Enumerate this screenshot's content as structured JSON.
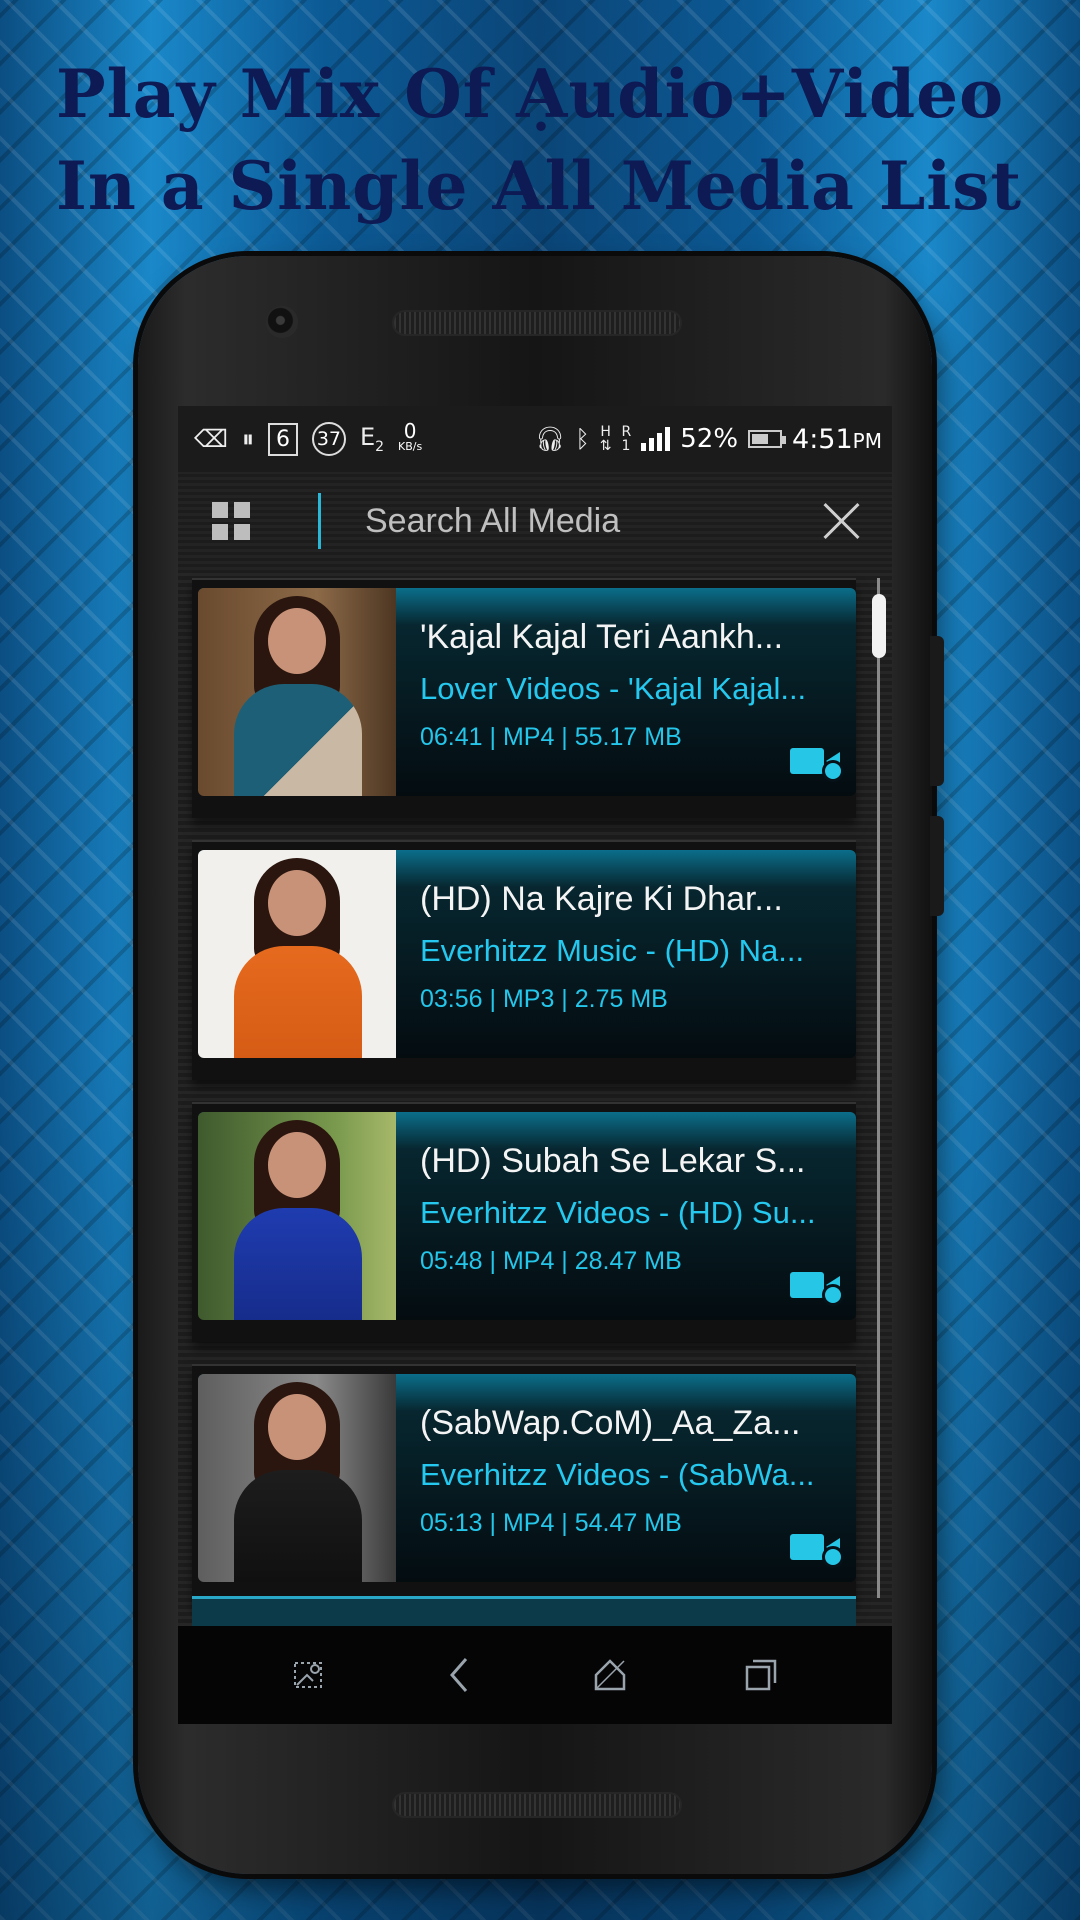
{
  "headline": {
    "line1": "Play Mix Of Ạudio+Video",
    "line2": "In a Single All Media List"
  },
  "status_bar": {
    "box_value": "6",
    "circle_value": "37",
    "e_label": "E",
    "e_sub": "2",
    "speed_value": "0",
    "speed_unit": "KB/s",
    "network_h": "H",
    "network_r": "R",
    "network_r_sub": "1",
    "battery": "52%",
    "time": "4:51",
    "time_suffix": "PM"
  },
  "search": {
    "placeholder": "Search All Media"
  },
  "media_list": [
    {
      "title": "'Kajal Kajal Teri Aankh...",
      "subtitle": "Lover Videos - 'Kajal Kajal...",
      "meta": "06:41 | MP4 | 55.17 MB",
      "kind": "video"
    },
    {
      "title": "(HD) Na Kajre Ki Dhar...",
      "subtitle": "Everhitzz Music - (HD) Na...",
      "meta": "03:56 | MP3 | 2.75 MB",
      "kind": "audio"
    },
    {
      "title": "(HD) Subah Se Lekar S...",
      "subtitle": "Everhitzz Videos - (HD) Su...",
      "meta": "05:48 | MP4 | 28.47 MB",
      "kind": "video"
    },
    {
      "title": "(SabWap.CoM)_Aa_Za...",
      "subtitle": "Everhitzz Videos - (SabWa...",
      "meta": "05:13 | MP4 | 54.47 MB",
      "kind": "video"
    }
  ],
  "colors": {
    "accent": "#25c8ee",
    "headline": "#0d1a54",
    "background": "#0b4e82"
  },
  "icons": {
    "grid": "grid-icon",
    "close": "close-icon",
    "video": "video-camera-icon",
    "nav": [
      "screenshot-icon",
      "back-icon",
      "home-icon",
      "recents-icon"
    ]
  }
}
